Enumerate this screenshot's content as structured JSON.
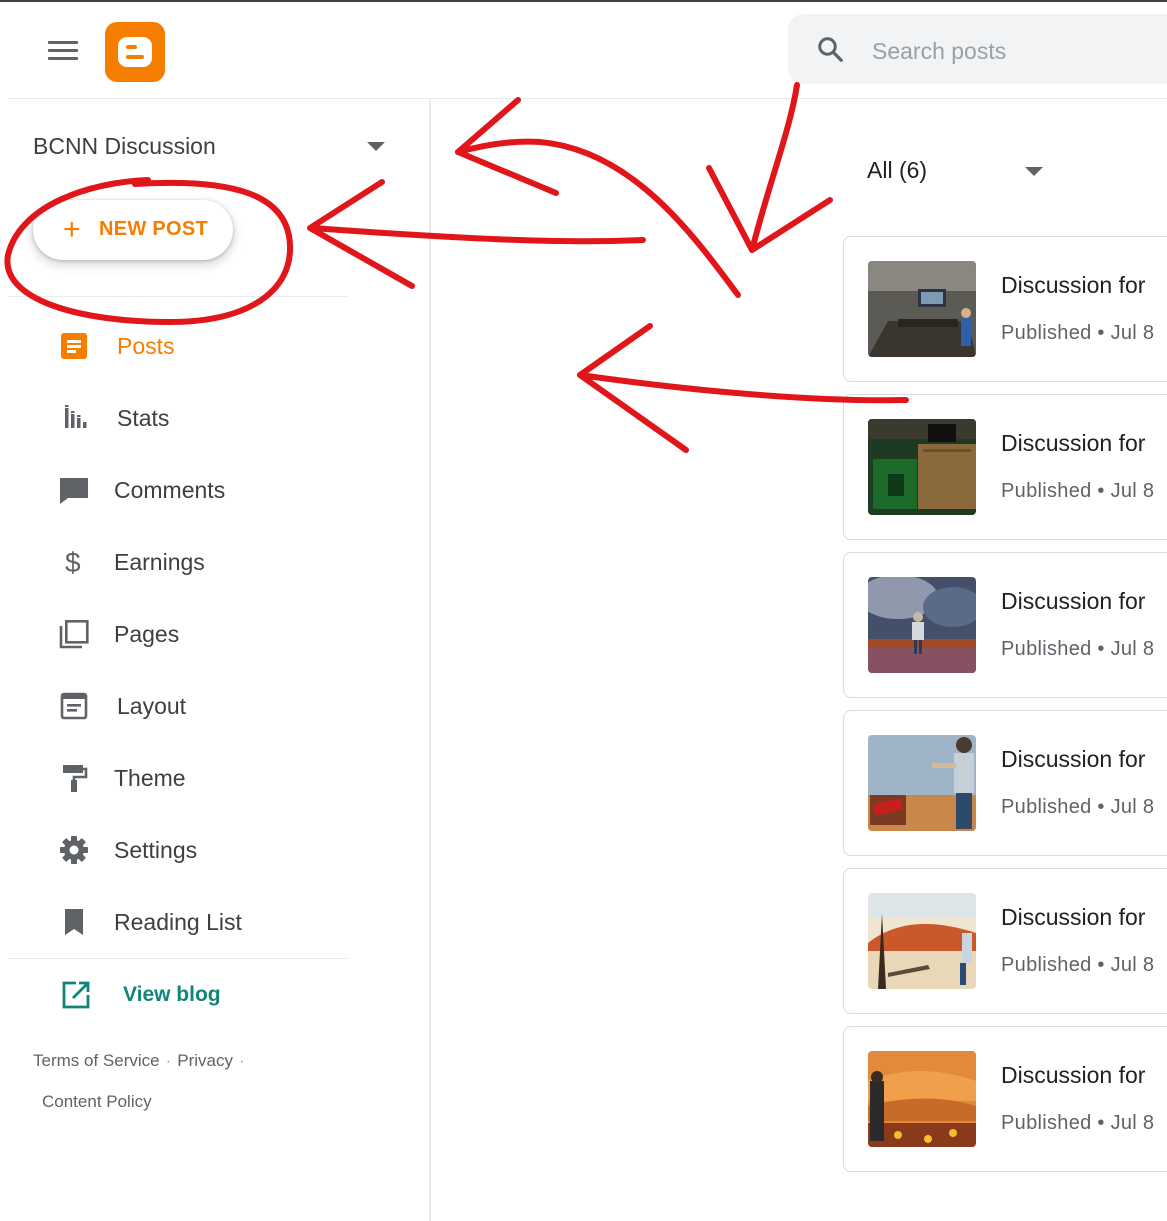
{
  "header": {
    "logo_icon": "blogger-logo-icon",
    "menu_icon": "hamburger-menu-icon",
    "search": {
      "placeholder": "Search posts",
      "icon": "search-icon"
    }
  },
  "sidebar": {
    "blog_name": "BCNN Discussion",
    "new_post": {
      "icon": "plus-icon",
      "label": "NEW POST"
    },
    "items": [
      {
        "label": "Posts",
        "icon": "posts-icon",
        "active": true
      },
      {
        "label": "Stats",
        "icon": "stats-icon"
      },
      {
        "label": "Comments",
        "icon": "comment-icon"
      },
      {
        "label": "Earnings",
        "icon": "dollar-icon"
      },
      {
        "label": "Pages",
        "icon": "pages-icon"
      },
      {
        "label": "Layout",
        "icon": "layout-icon"
      },
      {
        "label": "Theme",
        "icon": "paint-roller-icon"
      },
      {
        "label": "Settings",
        "icon": "gear-icon"
      },
      {
        "label": "Reading List",
        "icon": "bookmark-icon"
      }
    ],
    "view_blog": {
      "label": "View blog",
      "icon": "open-in-new-icon"
    },
    "footer": {
      "terms": "Terms of Service",
      "privacy": "Privacy",
      "separator": "·",
      "content_policy": "Content Policy"
    }
  },
  "main": {
    "filter_label": "All (6)",
    "posts": [
      {
        "title": "Discussion for",
        "status": "Published",
        "date": "Jul 8"
      },
      {
        "title": "Discussion for",
        "status": "Published",
        "date": "Jul 8"
      },
      {
        "title": "Discussion for",
        "status": "Published",
        "date": "Jul 8"
      },
      {
        "title": "Discussion for",
        "status": "Published",
        "date": "Jul 8"
      },
      {
        "title": "Discussion for",
        "status": "Published",
        "date": "Jul 8"
      },
      {
        "title": "Discussion for",
        "status": "Published",
        "date": "Jul 8"
      }
    ],
    "meta_separator": " • "
  },
  "colors": {
    "brand_orange": "#f57d00",
    "teal_link": "#12857a",
    "annotation_red": "#e0161b"
  }
}
